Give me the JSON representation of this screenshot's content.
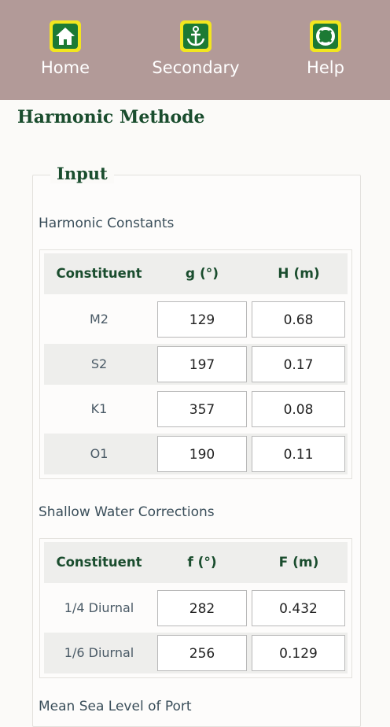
{
  "nav": {
    "items": [
      {
        "label": "Home",
        "icon": "home-icon"
      },
      {
        "label": "Secondary",
        "icon": "anchor-icon"
      },
      {
        "label": "Help",
        "icon": "lifebuoy-icon"
      }
    ]
  },
  "page_title": "Harmonic Methode",
  "input": {
    "legend": "Input",
    "harmonic": {
      "title": "Harmonic Constants",
      "headers": [
        "Constituent",
        "g (°)",
        "H (m)"
      ],
      "rows": [
        {
          "name": "M2",
          "g": "129",
          "h": "0.68"
        },
        {
          "name": "S2",
          "g": "197",
          "h": "0.17"
        },
        {
          "name": "K1",
          "g": "357",
          "h": "0.08"
        },
        {
          "name": "O1",
          "g": "190",
          "h": "0.11"
        }
      ]
    },
    "shallow": {
      "title": "Shallow Water Corrections",
      "headers": [
        "Constituent",
        "f (°)",
        "F (m)"
      ],
      "rows": [
        {
          "name": "1/4 Diurnal",
          "f": "282",
          "F": "0.432"
        },
        {
          "name": "1/6 Diurnal",
          "f": "256",
          "F": "0.129"
        }
      ]
    },
    "next_section_title": "Mean Sea Level of Port"
  },
  "colors": {
    "nav_bg": "#b29a98",
    "icon_bg": "#f2e61f",
    "icon_fg": "#1c7a34",
    "heading": "#1a4d2e"
  }
}
